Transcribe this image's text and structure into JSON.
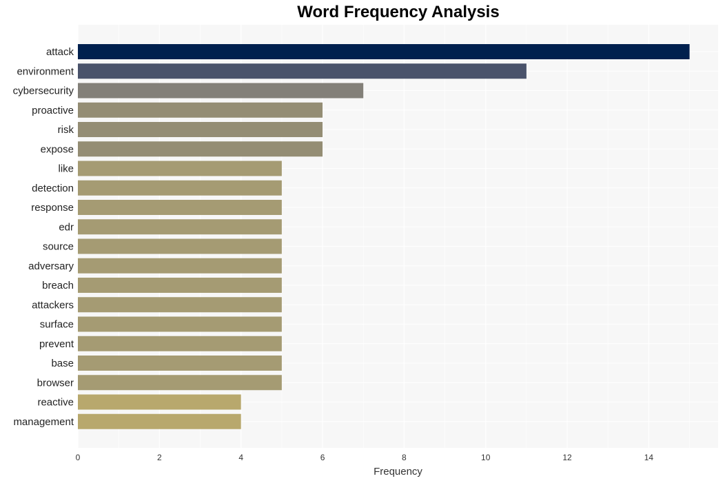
{
  "chart_data": {
    "type": "bar",
    "orientation": "horizontal",
    "title": "Word Frequency Analysis",
    "xlabel": "Frequency",
    "ylabel": "",
    "xlim": [
      0,
      15.7
    ],
    "xticks": [
      0,
      2,
      4,
      6,
      8,
      10,
      12,
      14
    ],
    "grid": true,
    "categories": [
      "attack",
      "environment",
      "cybersecurity",
      "proactive",
      "risk",
      "expose",
      "like",
      "detection",
      "response",
      "edr",
      "source",
      "adversary",
      "breach",
      "attackers",
      "surface",
      "prevent",
      "base",
      "browser",
      "reactive",
      "management"
    ],
    "values": [
      15,
      11,
      7,
      6,
      6,
      6,
      5,
      5,
      5,
      5,
      5,
      5,
      5,
      5,
      5,
      5,
      5,
      5,
      4,
      4
    ],
    "colors": [
      "#00204e",
      "#4a536b",
      "#838079",
      "#948d74",
      "#948d74",
      "#948d74",
      "#a59b73",
      "#a59b73",
      "#a59b73",
      "#a59b73",
      "#a59b73",
      "#a59b73",
      "#a59b73",
      "#a59b73",
      "#a59b73",
      "#a59b73",
      "#a59b73",
      "#a59b73",
      "#b8a86d",
      "#b8a86d"
    ],
    "background": "#f7f7f7",
    "grid_color": "#ffffff"
  }
}
